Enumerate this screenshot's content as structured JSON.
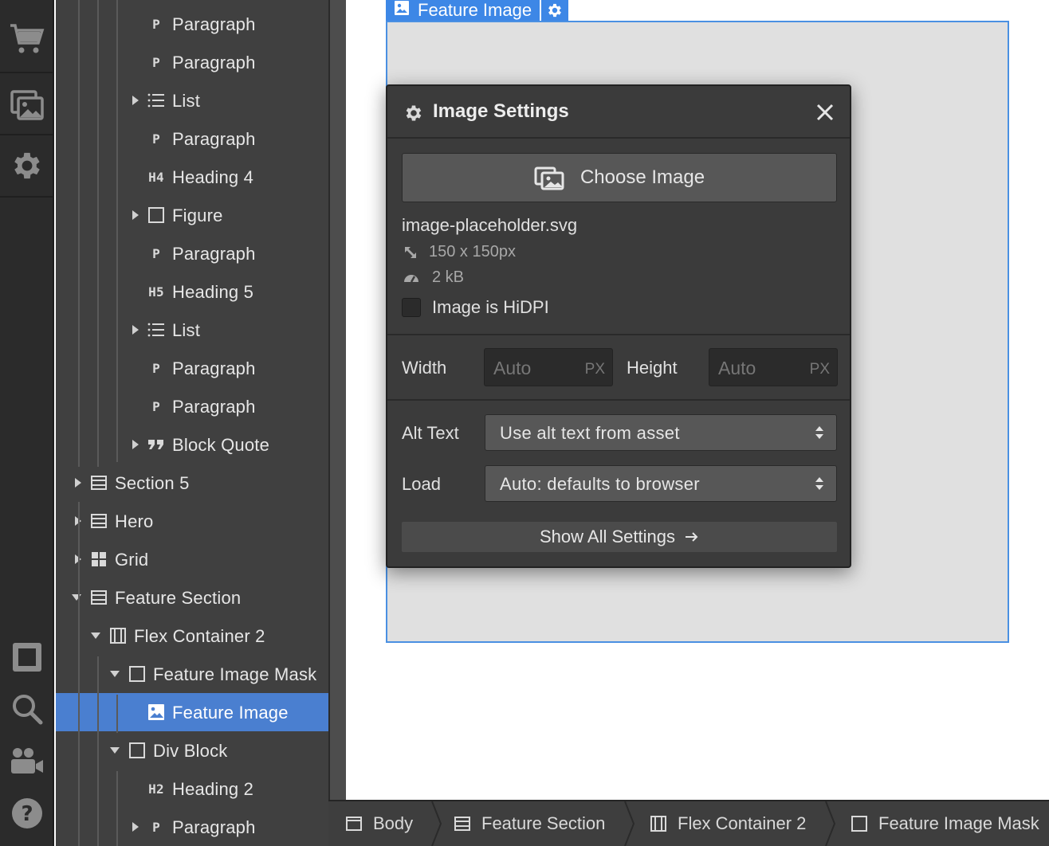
{
  "rail": {
    "icons": [
      "cart-icon",
      "assets-icon",
      "gear-icon",
      "preview-box-icon",
      "search-icon",
      "video-people-icon",
      "help-icon"
    ]
  },
  "navigator": {
    "rows": [
      {
        "label": "Paragraph",
        "icon": "paragraph-icon",
        "icon_text": "P",
        "caret": ""
      },
      {
        "label": "Paragraph",
        "icon": "paragraph-icon",
        "icon_text": "P",
        "caret": ""
      },
      {
        "label": "List",
        "icon": "list-icon",
        "icon_text": "",
        "caret": "right"
      },
      {
        "label": "Paragraph",
        "icon": "paragraph-icon",
        "icon_text": "P",
        "caret": ""
      },
      {
        "label": "Heading 4",
        "icon": "heading-icon",
        "icon_text": "H4",
        "caret": ""
      },
      {
        "label": "Figure",
        "icon": "box-icon",
        "icon_text": "",
        "caret": "right"
      },
      {
        "label": "Paragraph",
        "icon": "paragraph-icon",
        "icon_text": "P",
        "caret": ""
      },
      {
        "label": "Heading 5",
        "icon": "heading-icon",
        "icon_text": "H5",
        "caret": ""
      },
      {
        "label": "List",
        "icon": "list-icon",
        "icon_text": "",
        "caret": "right"
      },
      {
        "label": "Paragraph",
        "icon": "paragraph-icon",
        "icon_text": "P",
        "caret": ""
      },
      {
        "label": "Paragraph",
        "icon": "paragraph-icon",
        "icon_text": "P",
        "caret": ""
      },
      {
        "label": "Block Quote",
        "icon": "quote-icon",
        "icon_text": "",
        "caret": "right"
      },
      {
        "label": "Section 5",
        "icon": "section-icon",
        "icon_text": "",
        "caret": "right"
      },
      {
        "label": "Hero",
        "icon": "section-icon",
        "icon_text": "",
        "caret": "right"
      },
      {
        "label": "Grid",
        "icon": "grid-icon",
        "icon_text": "",
        "caret": "right"
      },
      {
        "label": "Feature Section",
        "icon": "section-icon",
        "icon_text": "",
        "caret": "down"
      },
      {
        "label": "Flex Container 2",
        "icon": "container-icon",
        "icon_text": "",
        "caret": "down"
      },
      {
        "label": "Feature Image Mask",
        "icon": "box-icon",
        "icon_text": "",
        "caret": "down"
      },
      {
        "label": "Feature Image",
        "icon": "image-icon",
        "icon_text": "",
        "caret": "",
        "selected": true
      },
      {
        "label": "Div Block",
        "icon": "box-icon",
        "icon_text": "",
        "caret": "down"
      },
      {
        "label": "Heading 2",
        "icon": "heading-icon",
        "icon_text": "H2",
        "caret": ""
      },
      {
        "label": "Paragraph",
        "icon": "paragraph-icon",
        "icon_text": "P",
        "caret": "right"
      }
    ]
  },
  "canvas": {
    "element_tag": "Feature Image"
  },
  "image_settings": {
    "title": "Image Settings",
    "choose_image": "Choose Image",
    "file_name": "image-placeholder.svg",
    "dimensions": "150 x 150px",
    "file_size": "2 kB",
    "hidpi_label": "Image is HiDPI",
    "hidpi_checked": false,
    "width_label": "Width",
    "width_placeholder": "Auto",
    "width_unit": "PX",
    "height_label": "Height",
    "height_placeholder": "Auto",
    "height_unit": "PX",
    "alt_label": "Alt Text",
    "alt_value": "Use alt text from asset",
    "load_label": "Load",
    "load_value": "Auto: defaults to browser",
    "show_all": "Show All Settings"
  },
  "breadcrumbs": [
    {
      "label": "Body",
      "icon": "body-icon"
    },
    {
      "label": "Feature Section",
      "icon": "section-icon"
    },
    {
      "label": "Flex Container 2",
      "icon": "container-icon"
    },
    {
      "label": "Feature Image Mask",
      "icon": "box-icon"
    }
  ],
  "colors": {
    "selection": "#4a7fd0",
    "canvas_outline": "#4a90e2",
    "panel": "#404040"
  }
}
